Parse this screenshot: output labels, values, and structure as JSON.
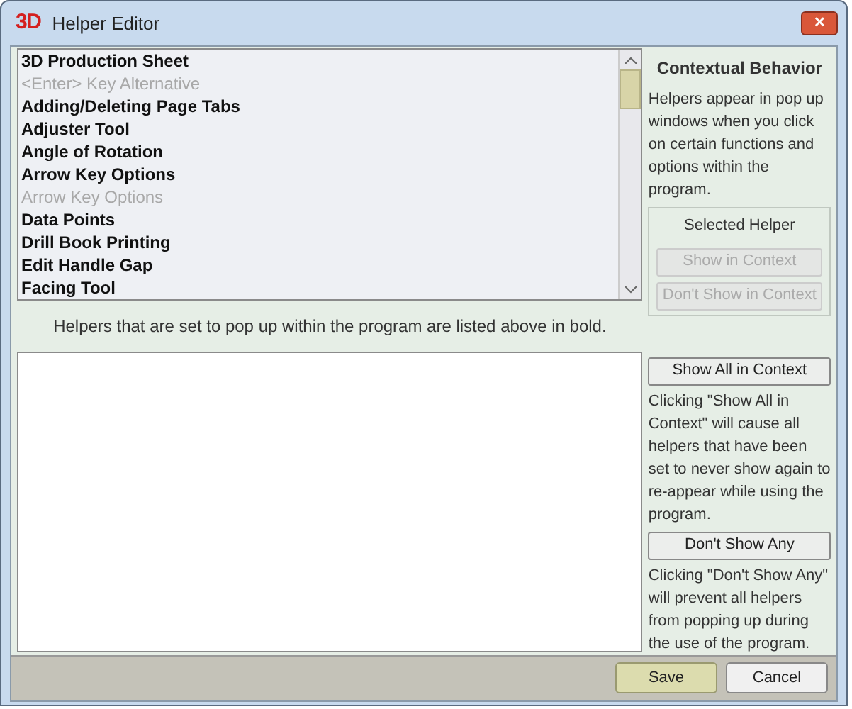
{
  "window": {
    "logo": "3D",
    "title": "Helper Editor",
    "close": "✕"
  },
  "helpers": [
    {
      "label": "3D Production Sheet",
      "shown": true
    },
    {
      "label": "<Enter> Key Alternative",
      "shown": false
    },
    {
      "label": "Adding/Deleting Page Tabs",
      "shown": true
    },
    {
      "label": "Adjuster Tool",
      "shown": true
    },
    {
      "label": "Angle of Rotation",
      "shown": true
    },
    {
      "label": "Arrow Key Options",
      "shown": true
    },
    {
      "label": "Arrow Key Options",
      "shown": false
    },
    {
      "label": "Data Points",
      "shown": true
    },
    {
      "label": "Drill Book Printing",
      "shown": true
    },
    {
      "label": "Edit Handle Gap",
      "shown": true
    },
    {
      "label": "Facing Tool",
      "shown": true
    }
  ],
  "list_note": "Helpers that are set to pop up within the program are listed above in bold.",
  "side": {
    "heading": "Contextual Behavior",
    "intro": "Helpers appear in pop up windows when you click on certain functions and options within the program.",
    "group": {
      "title": "Selected Helper",
      "buttons": [
        {
          "label": "Show in Context",
          "disabled": true
        },
        {
          "label": "Don't Show in Context",
          "disabled": true
        }
      ]
    },
    "show_all": {
      "label": "Show All in Context",
      "disabled": false
    },
    "show_all_note": "Clicking \"Show All in Context\" will cause all helpers that have been set to never show again to re-appear while using the program.",
    "dont_show": {
      "label": "Don't Show Any",
      "disabled": false
    },
    "dont_show_note": "Clicking \"Don't Show Any\" will prevent all helpers from popping up during the use of the program."
  },
  "footer": {
    "buttons": [
      {
        "label": "Save",
        "kind": "default"
      },
      {
        "label": "Cancel",
        "kind": "normal"
      }
    ]
  }
}
